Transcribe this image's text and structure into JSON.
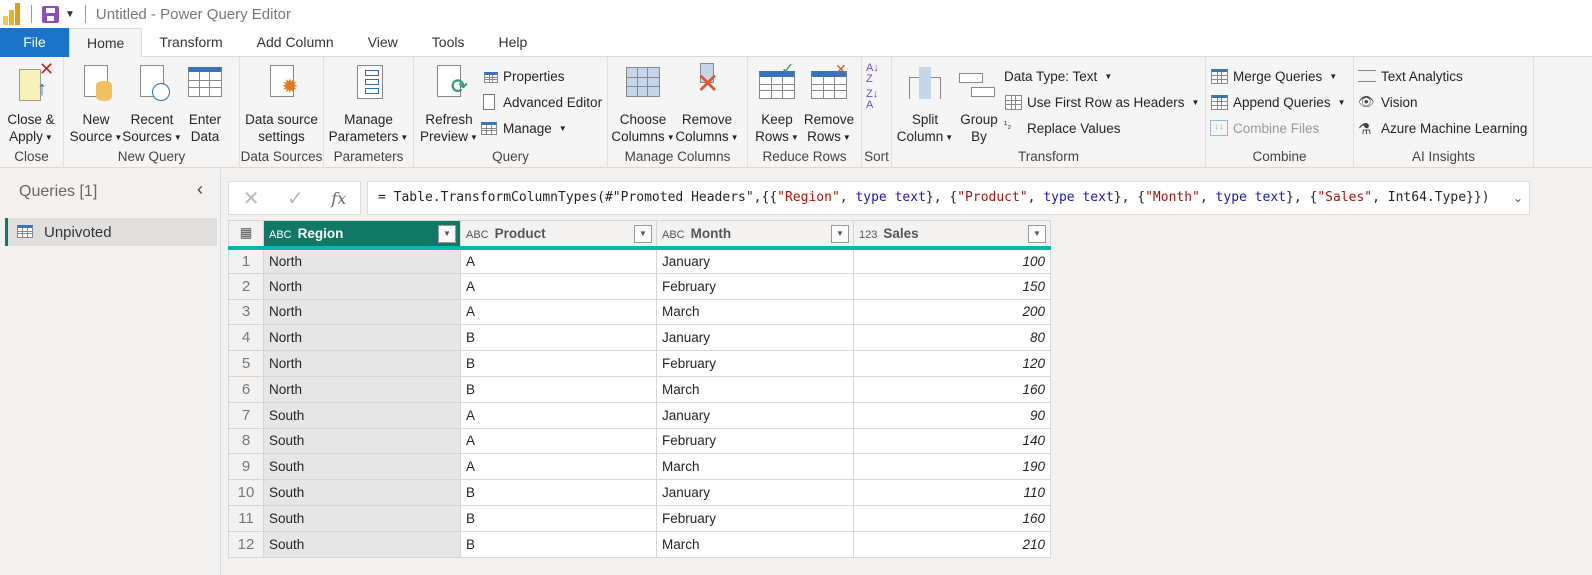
{
  "titlebar": {
    "title": "Untitled - Power Query Editor"
  },
  "tabs": [
    "File",
    "Home",
    "Transform",
    "Add Column",
    "View",
    "Tools",
    "Help"
  ],
  "ribbon": {
    "close": {
      "label": "Close",
      "close_apply": "Close &",
      "close_apply2": "Apply"
    },
    "new_query": {
      "label": "New Query",
      "new_source": [
        "New",
        "Source"
      ],
      "recent_sources": [
        "Recent",
        "Sources"
      ],
      "enter_data": [
        "Enter",
        "Data"
      ]
    },
    "data_sources": {
      "label": "Data Sources",
      "settings": [
        "Data source",
        "settings"
      ]
    },
    "parameters": {
      "label": "Parameters",
      "manage": [
        "Manage",
        "Parameters"
      ]
    },
    "query": {
      "label": "Query",
      "refresh": [
        "Refresh",
        "Preview"
      ],
      "properties": "Properties",
      "advanced_editor": "Advanced Editor",
      "manage": "Manage"
    },
    "manage_columns": {
      "label": "Manage Columns",
      "choose": [
        "Choose",
        "Columns"
      ],
      "remove": [
        "Remove",
        "Columns"
      ]
    },
    "reduce_rows": {
      "label": "Reduce Rows",
      "keep": [
        "Keep",
        "Rows"
      ],
      "remove": [
        "Remove",
        "Rows"
      ]
    },
    "sort": {
      "label": "Sort"
    },
    "transform": {
      "label": "Transform",
      "split": [
        "Split",
        "Column"
      ],
      "group": [
        "Group",
        "By"
      ],
      "data_type": "Data Type: Text",
      "first_row": "Use First Row as Headers",
      "replace": "Replace Values"
    },
    "combine": {
      "label": "Combine",
      "merge": "Merge Queries",
      "append": "Append Queries",
      "combine_files": "Combine Files"
    },
    "ai": {
      "label": "AI Insights",
      "text_analytics": "Text Analytics",
      "vision": "Vision",
      "azure_ml": "Azure Machine Learning"
    }
  },
  "queries": {
    "title": "Queries [1]",
    "items": [
      "Unpivoted"
    ]
  },
  "formula": {
    "p1": "= Table.TransformColumnTypes(#\"Promoted Headers\",{{",
    "s1": "\"Region\"",
    "k": "type text",
    "s2": "\"Product\"",
    "s3": "\"Month\"",
    "s4": "\"Sales\"",
    "t4": "Int64.Type"
  },
  "table": {
    "columns": [
      {
        "name": "Region",
        "type": "ABC"
      },
      {
        "name": "Product",
        "type": "ABC"
      },
      {
        "name": "Month",
        "type": "ABC"
      },
      {
        "name": "Sales",
        "type": "123"
      }
    ],
    "rows": [
      [
        "1",
        "North",
        "A",
        "January",
        "100"
      ],
      [
        "2",
        "North",
        "A",
        "February",
        "150"
      ],
      [
        "3",
        "North",
        "A",
        "March",
        "200"
      ],
      [
        "4",
        "North",
        "B",
        "January",
        "80"
      ],
      [
        "5",
        "North",
        "B",
        "February",
        "120"
      ],
      [
        "6",
        "North",
        "B",
        "March",
        "160"
      ],
      [
        "7",
        "South",
        "A",
        "January",
        "90"
      ],
      [
        "8",
        "South",
        "A",
        "February",
        "140"
      ],
      [
        "9",
        "South",
        "A",
        "March",
        "190"
      ],
      [
        "10",
        "South",
        "B",
        "January",
        "110"
      ],
      [
        "11",
        "South",
        "B",
        "February",
        "160"
      ],
      [
        "12",
        "South",
        "B",
        "March",
        "210"
      ]
    ]
  }
}
